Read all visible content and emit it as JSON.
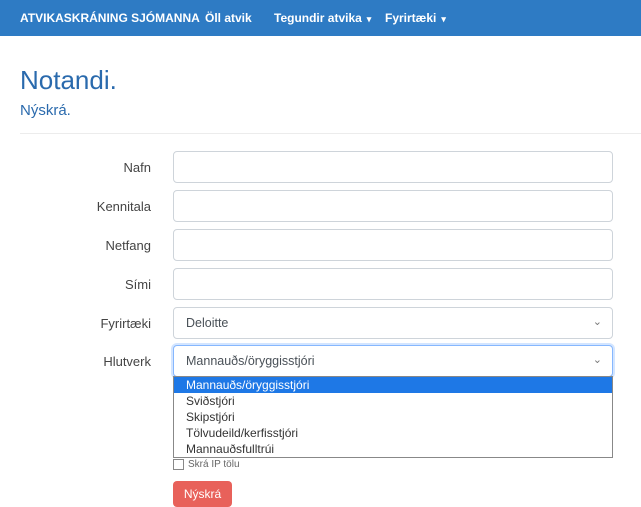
{
  "navbar": {
    "brand": "ATVIKASKRÁNING SJÓMANNA",
    "items": [
      {
        "label": "Öll atvik"
      },
      {
        "label": "Tegundir atvika"
      },
      {
        "label": "Fyrirtæki"
      }
    ]
  },
  "page": {
    "title": "Notandi.",
    "subtitle": "Nýskrá."
  },
  "form": {
    "name_label": "Nafn",
    "name_value": "",
    "kennitala_label": "Kennitala",
    "kennitala_value": "",
    "email_label": "Netfang",
    "email_value": "",
    "phone_label": "Sími",
    "phone_value": "",
    "company_label": "Fyrirtæki",
    "company_selected": "Deloitte",
    "role_label": "Hlutverk",
    "role_selected": "Mannauðs/öryggisstjóri",
    "role_options": [
      "Mannauðs/öryggisstjóri",
      "Sviðstjóri",
      "Skipstjóri",
      "Tölvudeild/kerfisstjóri",
      "Mannauðsfulltrúi"
    ],
    "ip_checkbox_label": "Skrá IP tölu",
    "ip_checkbox_checked": false,
    "submit_label": "Nýskrá"
  },
  "colors": {
    "navbar_bg": "#2e7bc4",
    "heading": "#2a6aad",
    "submit_bg": "#e8615a",
    "option_highlight": "#1e78e6"
  }
}
